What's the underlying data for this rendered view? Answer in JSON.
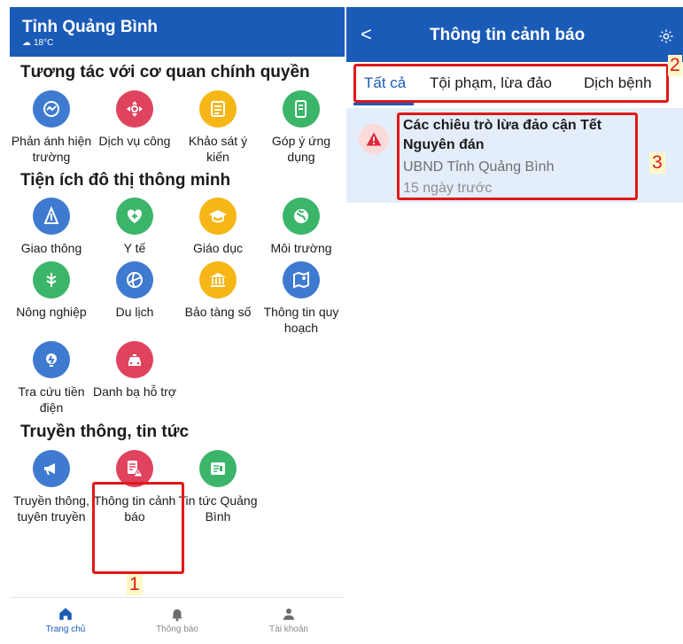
{
  "left": {
    "header": {
      "title": "Tỉnh Quảng Bình",
      "weather": "18°C"
    },
    "sections": [
      {
        "title": "Tương tác với cơ quan chính quyền",
        "items": [
          {
            "label": "Phản ánh hiện trường",
            "color": "#3e7ad0",
            "icon": "report-icon"
          },
          {
            "label": "Dịch vụ công",
            "color": "#e0435e",
            "icon": "public-service-icon"
          },
          {
            "label": "Khảo sát ý kiến",
            "color": "#f6b616",
            "icon": "survey-icon"
          },
          {
            "label": "Góp ý ứng dụng",
            "color": "#3bb56a",
            "icon": "feedback-icon"
          }
        ]
      },
      {
        "title": "Tiện ích đô thị thông minh",
        "items": [
          {
            "label": "Giao thông",
            "color": "#3e7ad0",
            "icon": "traffic-icon"
          },
          {
            "label": "Y tế",
            "color": "#3bb56a",
            "icon": "health-icon"
          },
          {
            "label": "Giáo dục",
            "color": "#f6b616",
            "icon": "education-icon"
          },
          {
            "label": "Môi trường",
            "color": "#3bb56a",
            "icon": "environment-icon"
          },
          {
            "label": "Nông nghiệp",
            "color": "#3bb56a",
            "icon": "agriculture-icon"
          },
          {
            "label": "Du lịch",
            "color": "#3e7ad0",
            "icon": "tourism-icon"
          },
          {
            "label": "Bảo tàng số",
            "color": "#f6b616",
            "icon": "museum-icon"
          },
          {
            "label": "Thông tin quy hoạch",
            "color": "#3e7ad0",
            "icon": "planning-map-icon"
          },
          {
            "label": "Tra cứu tiền điện",
            "color": "#3e7ad0",
            "icon": "electricity-icon"
          },
          {
            "label": "Danh bạ hỗ trợ",
            "color": "#e0435e",
            "icon": "taxi-icon"
          }
        ]
      },
      {
        "title": "Truyền thông, tin tức",
        "items": [
          {
            "label": "Truyền thông, tuyên truyền",
            "color": "#3e7ad0",
            "icon": "megaphone-icon"
          },
          {
            "label": "Thông tin cảnh báo",
            "color": "#e0435e",
            "icon": "warning-news-icon"
          },
          {
            "label": "Tin tức Quảng Bình",
            "color": "#3bb56a",
            "icon": "news-icon"
          }
        ]
      }
    ],
    "bottom_nav": [
      {
        "label": "Trang chủ",
        "icon": "home-icon",
        "active": true
      },
      {
        "label": "Thông báo",
        "icon": "bell-icon",
        "active": false
      },
      {
        "label": "Tài khoản",
        "icon": "user-icon",
        "active": false
      }
    ]
  },
  "right": {
    "header": {
      "back": "<",
      "title": "Thông tin cảnh báo",
      "settings_icon": "gear-icon"
    },
    "tabs": [
      "Tất cả",
      "Tội phạm, lừa đảo",
      "Dịch bệnh"
    ],
    "active_tab": "Tất cả",
    "alert": {
      "title": "Các chiêu trò lừa đảo cận Tết Nguyên đán",
      "source": "UBND Tỉnh Quảng Bình",
      "time": "15 ngày trước"
    }
  },
  "annotations": {
    "n1": "1",
    "n2": "2",
    "n3": "3",
    "color": "#e01818"
  },
  "colors": {
    "brand_blue": "#1b5bb8",
    "alert_bg": "#e4eefa"
  }
}
